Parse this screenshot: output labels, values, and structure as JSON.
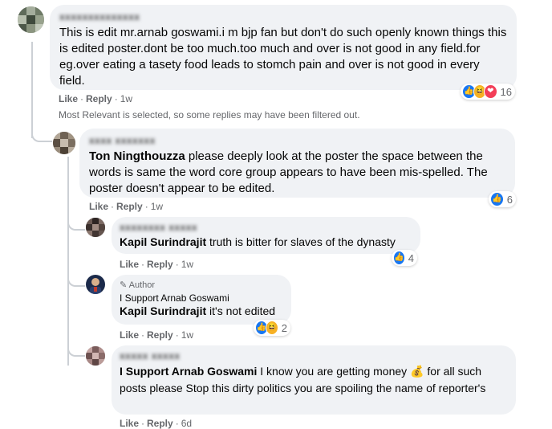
{
  "comments": [
    {
      "id": "c1",
      "author_blurred": "xxxxxxxxxxxxxx",
      "text": "This is edit mr.arnab goswami.i m bjp fan but don't do such openly known things this is edited poster.dont be too much.too much and over is not good in any field.for eg.over eating a tasety food leads to stomch pain and over is not good in every field.",
      "like_label": "Like",
      "reply_label": "Reply",
      "time": "1w",
      "reactions": [
        "like",
        "haha",
        "love"
      ],
      "reaction_count": "16"
    },
    {
      "id": "c2",
      "author_blurred": "xxxx xxxxxxx",
      "mention": "Ton Ningthouzza",
      "text": " please deeply look at the poster the space between the words is same the word core group appears to have been mis-spelled. The poster doesn't appear to be edited.",
      "like_label": "Like",
      "reply_label": "Reply",
      "time": "1w",
      "reactions": [
        "like"
      ],
      "reaction_count": "6"
    },
    {
      "id": "c3",
      "author_blurred": "xxxxxxxx xxxxx",
      "mention": "Kapil Surindrajit",
      "text": " truth is bitter for slaves of the dynasty",
      "like_label": "Like",
      "reply_label": "Reply",
      "time": "1w",
      "reactions": [
        "like"
      ],
      "reaction_count": "4"
    },
    {
      "id": "c4",
      "badge": "Author",
      "author": "I Support Arnab Goswami",
      "mention": "Kapil Surindrajit",
      "text": " it's not edited",
      "like_label": "Like",
      "reply_label": "Reply",
      "time": "1w",
      "reactions": [
        "like",
        "haha"
      ],
      "reaction_count": "2"
    },
    {
      "id": "c5",
      "author_blurred": "xxxxx xxxxx",
      "mention": "I Support Arnab Goswami",
      "text_before": " I know you are getting money ",
      "emoji": "💰",
      "text_after": " for all such posts please Stop this dirty politics you are spoiling the name of reporter's",
      "like_label": "Like",
      "reply_label": "Reply",
      "time": "6d"
    }
  ],
  "filter_notice": "Most Relevant is selected, so some replies may have been filtered out."
}
